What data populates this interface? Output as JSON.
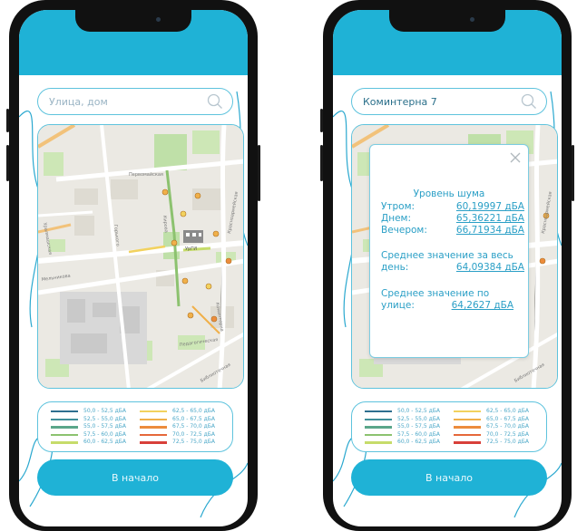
{
  "colors": {
    "accent": "#1fb2d6",
    "outline": "#5ec3dd",
    "text": "#2a9fc6"
  },
  "icons": {
    "search": "magnifier-icon",
    "close": "close-icon"
  },
  "screen_left": {
    "search": {
      "placeholder": "Улица, дом",
      "value": ""
    },
    "start_button": "В начало"
  },
  "screen_right": {
    "search": {
      "placeholder": "Улица, дом",
      "value": "Коминтерна 7"
    },
    "popup": {
      "title": "Уровень шума",
      "rows": [
        {
          "label": "Утром:",
          "value": "60,19997 дБА"
        },
        {
          "label": "Днем:",
          "value": "65,36221 дБА"
        },
        {
          "label": "Вечером:",
          "value": "66,71934 дБА"
        }
      ],
      "avg_day_label_1": "Среднее значение за весь",
      "avg_day_label_2": "день:",
      "avg_day_value": "64,09384 дБА",
      "avg_street_label_1": "Среднее значение по",
      "avg_street_label_2": "улице:",
      "avg_street_value": "64,2627 дБА"
    },
    "start_button": "В начало"
  },
  "legend": {
    "left": [
      {
        "range": "50,0 - 52,5 дБА",
        "color": "#2e6f8f"
      },
      {
        "range": "52,5 - 55,0 дБА",
        "color": "#3f8f99"
      },
      {
        "range": "55,0 - 57,5 дБА",
        "color": "#5aa68a"
      },
      {
        "range": "57,5 - 60,0 дБА",
        "color": "#8cc26f"
      },
      {
        "range": "60,0 - 62,5 дБА",
        "color": "#c6dc6a"
      }
    ],
    "right": [
      {
        "range": "62,5 - 65,0 дБА",
        "color": "#f2d25e"
      },
      {
        "range": "65,0 - 67,5 дБА",
        "color": "#f0b04a"
      },
      {
        "range": "67,5 - 70,0 дБА",
        "color": "#ec8c3c"
      },
      {
        "range": "70,0 - 72,5 дБА",
        "color": "#e5683a"
      },
      {
        "range": "72,5 - 75,0 дБА",
        "color": "#d8403a"
      }
    ]
  },
  "map": {
    "streets": [
      "Первомайская",
      "Красноармейская",
      "Горького",
      "Мельникова",
      "Коминтерна",
      "Уралмашская",
      "Педагогическая",
      "Библиотечная",
      "Кирова"
    ],
    "building_label": "УрГИ"
  }
}
